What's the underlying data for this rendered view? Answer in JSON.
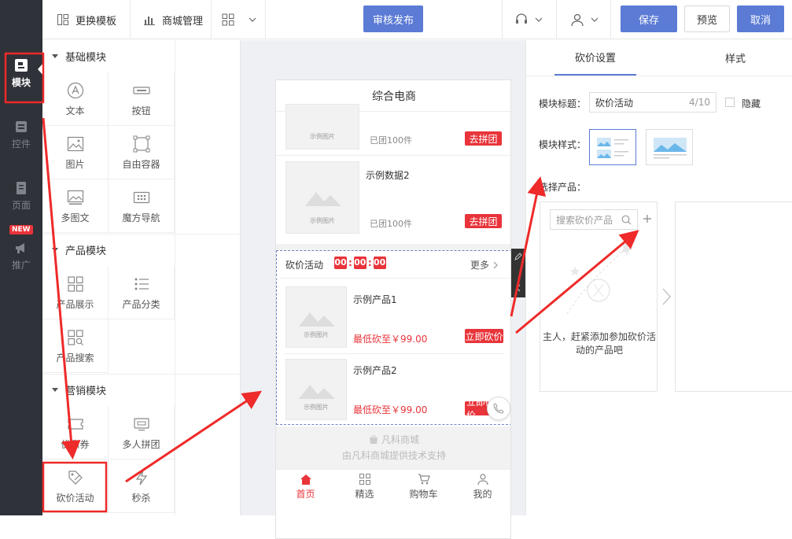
{
  "nav": {
    "items": [
      {
        "label": "模块",
        "icon": "module-icon"
      },
      {
        "label": "控件",
        "icon": "widget-icon"
      },
      {
        "label": "页面",
        "icon": "page-icon"
      },
      {
        "label": "推广",
        "icon": "megaphone-icon"
      }
    ],
    "new_badge": "NEW"
  },
  "toolbar": {
    "change_template": "更换模板",
    "store_manage": "商城管理",
    "publish": "审核发布",
    "save": "保存",
    "preview": "预览",
    "cancel": "取消"
  },
  "modules": {
    "basic": {
      "title": "基础模块",
      "items": [
        "文本",
        "按钮",
        "图片",
        "自由容器",
        "多图文",
        "魔方导航"
      ]
    },
    "product": {
      "title": "产品模块",
      "items": [
        "产品展示",
        "产品分类",
        "产品搜索"
      ]
    },
    "marketing": {
      "title": "营销模块",
      "items": [
        "优惠券",
        "多人拼团",
        "砍价活动",
        "秒杀"
      ]
    }
  },
  "phone": {
    "title": "综合电商",
    "placeholder_label": "示例图片",
    "group_items": [
      {
        "name": "",
        "sold": "已团100件",
        "button": "去拼团"
      },
      {
        "name": "示例数据2",
        "sold": "已团100件",
        "button": "去拼团"
      }
    ],
    "bargain": {
      "title": "砍价活动",
      "countdown": [
        "00",
        "00",
        "00"
      ],
      "more": "更多",
      "products": [
        {
          "name": "示例产品1",
          "price": "最低砍至￥99.00",
          "button": "立即砍价"
        },
        {
          "name": "示例产品2",
          "price": "最低砍至￥99.00",
          "button": "立即砍价"
        }
      ]
    },
    "footer": {
      "brand": "凡科商城",
      "support": "由凡科商城提供技术支持"
    },
    "tabs": [
      "首页",
      "精选",
      "购物车",
      "我的"
    ]
  },
  "settings": {
    "tabs": [
      "砍价设置",
      "样式"
    ],
    "module_title_label": "模块标题：",
    "module_title_value": "砍价活动",
    "module_title_count": "4/10",
    "hide_label": "隐藏",
    "module_style_label": "模块样式：",
    "select_product_label": "选择产品：",
    "search_placeholder": "搜索砍价产品",
    "empty_text": "主人，赶紧添加参加砍价活动的产品吧"
  },
  "colors": {
    "accent": "#5b7bd5",
    "red": "#e8343a",
    "nav_bg": "#2f3238"
  }
}
